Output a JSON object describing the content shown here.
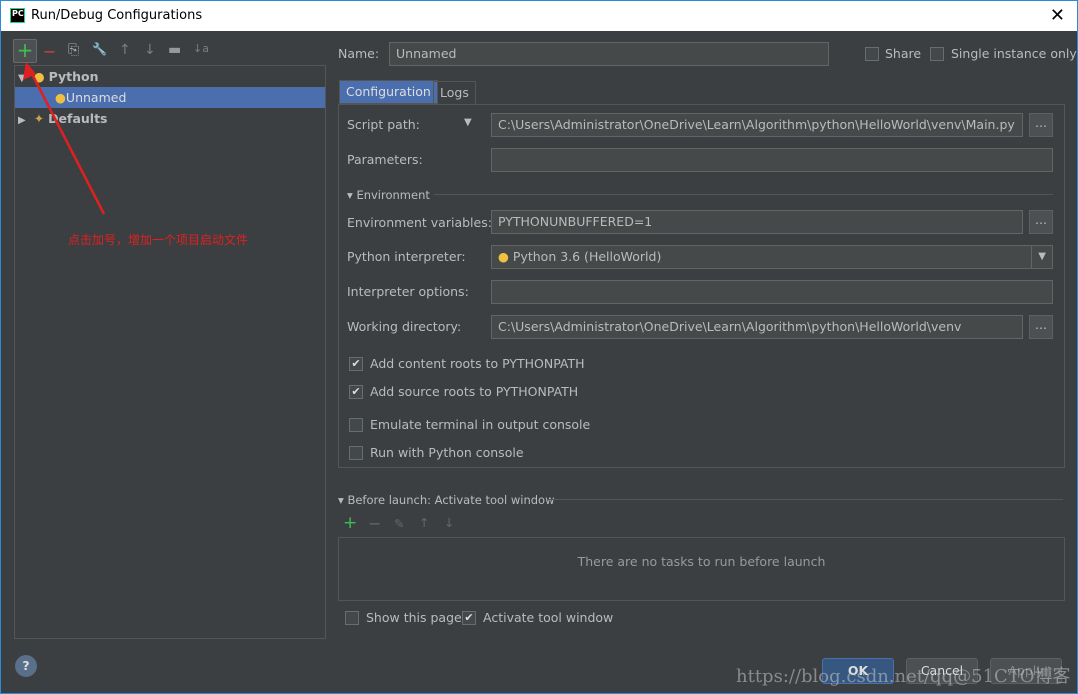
{
  "window": {
    "title": "Run/Debug Configurations",
    "logo": "PC",
    "close": "✕"
  },
  "toolbar": {
    "add": "+",
    "remove": "−",
    "copy": "⎘",
    "edit": "🔧",
    "up": "↑",
    "down": "↓",
    "folder": "▬",
    "sort": "↓a"
  },
  "tree": {
    "python": "Python",
    "unnamed": "Unnamed",
    "defaults": "Defaults"
  },
  "annotation": "点击加号，增加一个项目启动文件",
  "name": {
    "label": "Name:",
    "value": "Unnamed"
  },
  "share": "Share",
  "single_instance": "Single instance only",
  "tabs": [
    "Configuration",
    "Logs"
  ],
  "config": {
    "script_path_label": "Script path:",
    "script_path": "C:\\Users\\Administrator\\OneDrive\\Learn\\Algorithm\\python\\HelloWorld\\venv\\Main.py",
    "parameters_label": "Parameters:",
    "environment": "Environment",
    "env_vars_label": "Environment variables:",
    "env_vars": "PYTHONUNBUFFERED=1",
    "interpreter_label": "Python interpreter:",
    "interpreter": "Python 3.6 (HelloWorld)",
    "interp_options_label": "Interpreter options:",
    "workdir_label": "Working directory:",
    "workdir": "C:\\Users\\Administrator\\OneDrive\\Learn\\Algorithm\\python\\HelloWorld\\venv",
    "browse": "...",
    "checks": [
      {
        "label": "Add content roots to PYTHONPATH",
        "checked": true
      },
      {
        "label": "Add source roots to PYTHONPATH",
        "checked": true
      },
      {
        "label": "Emulate terminal in output console",
        "checked": false
      },
      {
        "label": "Run with Python console",
        "checked": false
      }
    ]
  },
  "before_launch": {
    "title": "Before launch: Activate tool window",
    "empty": "There are no tasks to run before launch"
  },
  "show_page": {
    "label": "Show this page",
    "checked": false
  },
  "activate_tool": {
    "label": "Activate tool window",
    "checked": true
  },
  "buttons": {
    "help": "?",
    "ok": "OK",
    "cancel": "Cancel",
    "apply": "Apply"
  },
  "watermark": "https://blog.csdn.net/qq@51CTO博客"
}
